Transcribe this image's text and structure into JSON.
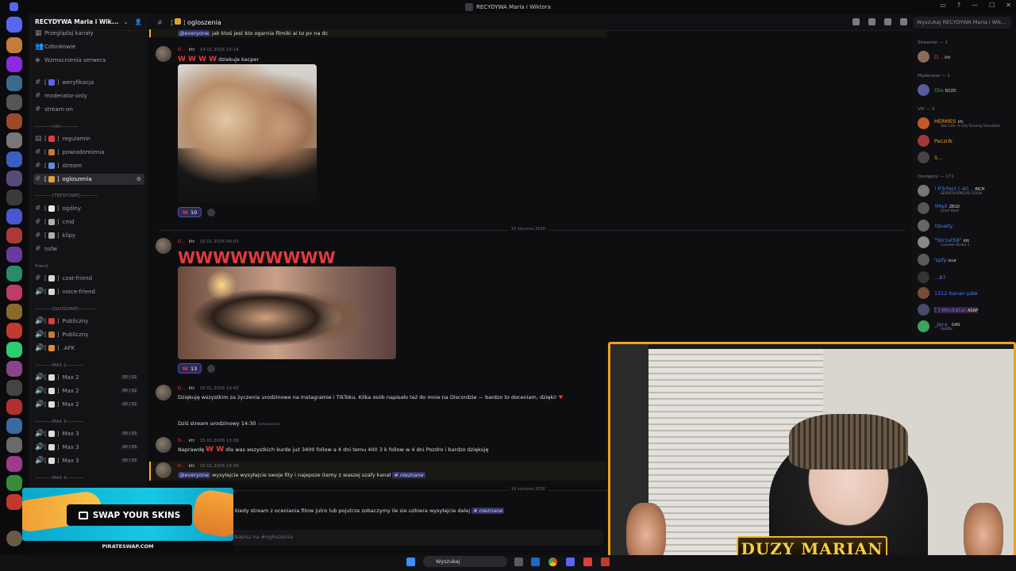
{
  "window": {
    "title": "RECYDYWA Maria i Wiktora"
  },
  "guild": {
    "name": "RECYDYWA Maria i Wik..."
  },
  "sidebar": {
    "top_items": [
      "Przeglądaj kanały",
      "Członkowie",
      "Wzmocnienia serwera"
    ],
    "channels_a": [
      {
        "label": "weryfikacja",
        "color": "#5865f2"
      },
      {
        "label": "moderator-only",
        "color": ""
      },
      {
        "label": "stream-on",
        "color": ""
      }
    ],
    "cat_info": "————info————",
    "channels_info": [
      {
        "label": "regulamin",
        "color": "#e23b3b"
      },
      {
        "label": "powiadomienia",
        "color": "#c97a3a"
      },
      {
        "label": "stream",
        "color": "#5b8fd9"
      },
      {
        "label": "ogloszenia",
        "color": "#e0a13a"
      }
    ],
    "cat_text": "————[TEKSTOWE]————",
    "channels_text": [
      {
        "label": "ogólny",
        "color": "#e8e8e8"
      },
      {
        "label": "cmd",
        "color": "#b0b0b0"
      },
      {
        "label": "klipy",
        "color": "#b0b0b0"
      },
      {
        "label": "nsfw",
        "color": ""
      }
    ],
    "cat_friend": "friend",
    "channels_friend": [
      {
        "label": "czat-friend",
        "color": "#d8d8d8"
      },
      {
        "label": "voice-friend",
        "color": "#d8d8d8"
      }
    ],
    "cat_voice": "————[GŁOSOWE]————",
    "channels_voice": [
      {
        "label": "Publiczny",
        "color": "#e23b3b"
      },
      {
        "label": "Publiczny",
        "color": "#c97a3a"
      },
      {
        "label": ".AFK",
        "color": "#e08a3a"
      }
    ],
    "cat_max2": "————MAX 2————",
    "channels_max2": [
      {
        "label": "Max 2",
        "badge": "00 / 02"
      },
      {
        "label": "Max 2",
        "badge": "00 / 02"
      },
      {
        "label": "Max 2",
        "badge": "00 / 02"
      }
    ],
    "cat_max3": "————MAX 3————",
    "channels_max3": [
      {
        "label": "Max 3",
        "badge": "00 / 03"
      },
      {
        "label": "Max 3",
        "badge": "00 / 03"
      },
      {
        "label": "Max 3",
        "badge": "00 / 03"
      }
    ],
    "cat_max4": "————MAX 4————"
  },
  "chat": {
    "channel": "ogloszenia",
    "search_placeholder": "Wyszukaj RECYDYWA Maria i Wik...",
    "input_placeholder": "Napisz na #ogloszenia",
    "msg0_text": "jak ktoś jest kto ogarnia filmiki ai to pv na dc",
    "msg0_mention": "@everyone",
    "author_short": "D...",
    "author_tag": "kfc",
    "msg1": {
      "ts": "14.01.2026 22:14",
      "ww": "W W W W",
      "text": "dziekuje kacper",
      "react_count": "10"
    },
    "day1": "15 stycznia 2026",
    "msg2": {
      "ts": "15.01.2026 00:03",
      "big": "WWWWWWWWW",
      "react_count": "13"
    },
    "msg3": {
      "ts": "15.01.2026 10:43",
      "text": "Dziękuję wszystkim za życzenia urodzinowe na Instagramie i TikToku. Kilka osób napisało też do mnie na Discordzie — bardzo to doceniam, dzięki!"
    },
    "msg3b": {
      "text": "Dziś stream urodzinowy 14:30",
      "edited": "(edytowano)"
    },
    "msg4": {
      "ts": "15.01.2026 13:39",
      "pre": "Naprawdę",
      "ww": "W W",
      "text": "dla was wszystkich kurde już 3400 follow a 4 dni temu 400 3 k follow w 4 dni Pozdro i bardzo dziękuję"
    },
    "msg5": {
      "ts": "15.01.2026 19:34",
      "mention": "@everyone",
      "text": "wysyłajcie wysyłajcie swoje fity i najepsze itemy z waszej szafy kanał",
      "channel_ref": "# nieznane"
    },
    "day2": "16 stycznia 2026",
    "msg6": {
      "text": "kiedy stream z oceniania fitow jutro lub pojutrze  zobaczymy ile sie uzbiera wysyłajcie dalej",
      "channel_ref": "# nieznane"
    }
  },
  "members": {
    "groups": [
      {
        "label": "Streamer — 1"
      },
      {
        "label": "Moderator — 1"
      },
      {
        "label": "VIP — 3"
      },
      {
        "label": "Dostępny — 171"
      }
    ],
    "list": [
      {
        "name": "D...",
        "color": "#e04a4a",
        "badge": "kfc",
        "sub": ""
      },
      {
        "name": "Oto",
        "color": "#3ba55c",
        "badge": "BZZR",
        "sub": ""
      },
      {
        "name": "HERMES",
        "color": "#f0a020",
        "badge": "kfc",
        "sub": "Taxi Life: A City Driving Simulator"
      },
      {
        "name": "Peczrik",
        "color": "#f0a020",
        "badge": "",
        "sub": ""
      },
      {
        "name": "S...",
        "color": "#f0a020",
        "badge": "",
        "sub": ""
      },
      {
        "name": "! P3rfect (-40...",
        "color": "#4a7bff",
        "badge": "RICH",
        "sub": "SERVER/SPREAD SOON"
      },
      {
        "name": "!MaX",
        "color": "#4a7bff",
        "badge": "ZELO",
        "sub": "Chief Keef"
      },
      {
        "name": "!Qually",
        "color": "#4a7bff",
        "badge": "",
        "sub": ""
      },
      {
        "name": "\"Skrzat58\"",
        "color": "#4a7bff",
        "badge": "kfc",
        "sub": "Counter-Strike 2"
      },
      {
        "name": "'spfy",
        "color": "#4a7bff",
        "badge": "scur",
        "sub": ""
      },
      {
        "name": "...87",
        "color": "#4a7bff",
        "badge": "",
        "sub": ""
      },
      {
        "name": "1312 banan pdw",
        "color": "#4a7bff",
        "badge": "",
        "sub": ""
      },
      {
        "name": "[ ] Wock$tar",
        "color": "#4a7bff",
        "badge": "ASAP",
        "sub": ""
      },
      {
        "name": "_Jaca_",
        "color": "#4a7bff",
        "badge": "G4S",
        "sub": "Roblox"
      }
    ]
  },
  "overlay": {
    "cam_name": "DUZY MARIAN"
  },
  "ad": {
    "button": "SWAP YOUR SKINS",
    "url": "PIRATESWAP.COM"
  },
  "taskbar": {
    "search": "Wyszukaj"
  }
}
